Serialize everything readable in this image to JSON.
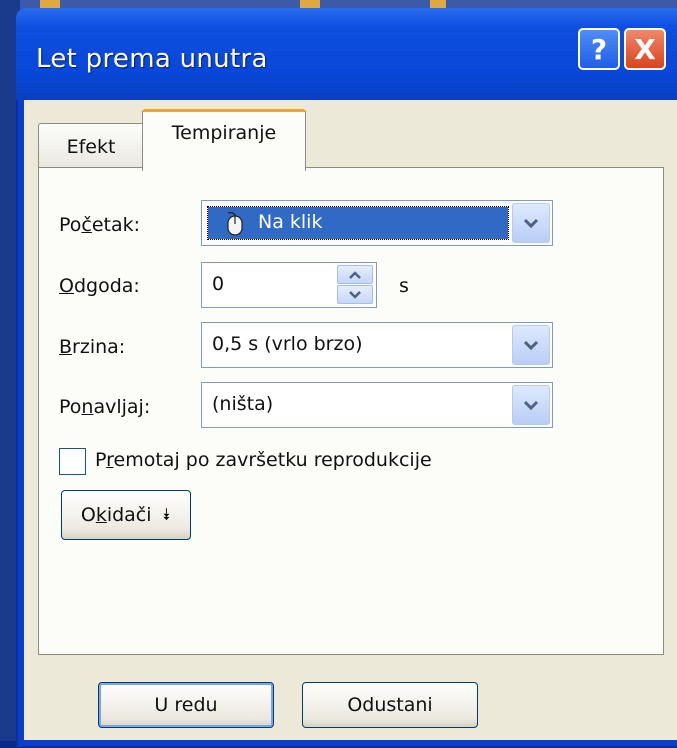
{
  "dialog": {
    "title": "Let prema unutra",
    "help_label": "?",
    "close_label": "X"
  },
  "tabs": [
    {
      "label": "Efekt"
    },
    {
      "label": "Tempiranje",
      "active": true
    }
  ],
  "form": {
    "start": {
      "label_pre": "Po",
      "label_key": "č",
      "label_post": "etak:",
      "value": "Na klik",
      "icon": "mouse-icon"
    },
    "delay": {
      "label_key": "O",
      "label_post": "dgoda:",
      "value": "0",
      "unit": "s"
    },
    "speed": {
      "label_key": "B",
      "label_post": "rzina:",
      "value": "0,5 s (vrlo brzo)"
    },
    "repeat": {
      "label_pre": "Po",
      "label_key": "n",
      "label_post": "avljaj:",
      "value": "(ništa)"
    },
    "rewind": {
      "label_pre": "P",
      "label_key": "r",
      "label_post": "emotaj po završetku reprodukcije",
      "checked": false
    },
    "triggers": {
      "label_pre": "O",
      "label_key": "k",
      "label_post": "idači",
      "arrow": "⯯"
    }
  },
  "buttons": {
    "ok": "U redu",
    "cancel": "Odustani"
  }
}
